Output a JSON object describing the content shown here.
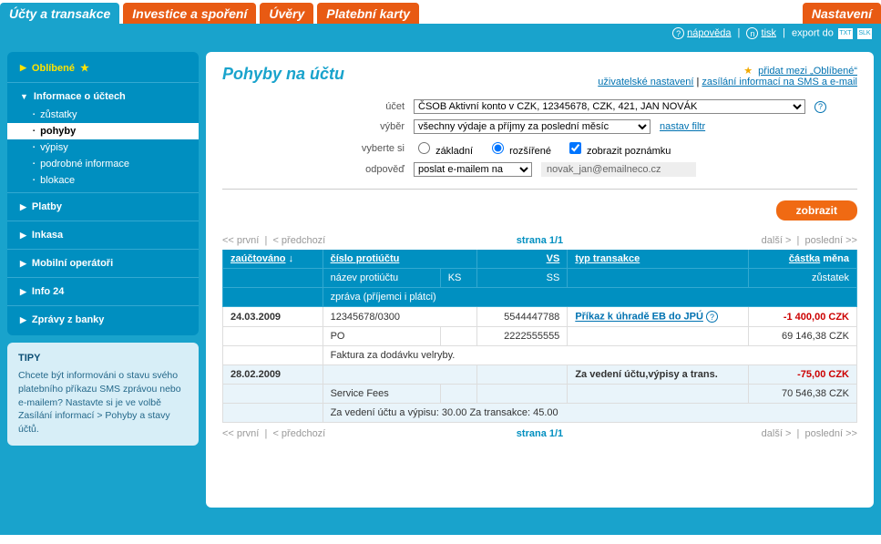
{
  "tabs": {
    "accounts": "Účty a transakce",
    "investments": "Investice a spoření",
    "loans": "Úvěry",
    "cards": "Platební karty",
    "settings": "Nastavení"
  },
  "header": {
    "help": "nápověda",
    "print": "tisk",
    "export": "export do",
    "fmt1": "TXT",
    "fmt2": "SLK"
  },
  "sidebar": {
    "favorites": "Oblíbené",
    "section_accounts": "Informace o účtech",
    "items": {
      "balances": "zůstatky",
      "movements": "pohyby",
      "statements": "výpisy",
      "details": "podrobné informace",
      "block": "blokace"
    },
    "payments": "Platby",
    "collections": "Inkasa",
    "mobile": "Mobilní operátoři",
    "info24": "Info 24",
    "messages": "Zprávy z banky"
  },
  "tips": {
    "title": "TIPY",
    "body": "Chcete být informováni o stavu svého platebního příkazu SMS zprávou nebo e-mailem? Nastavte si je ve volbě Zasílání informací > Pohyby a stavy účtů."
  },
  "page": {
    "title": "Pohyby na účtu",
    "add_fav": "přidat mezi „Oblíbené“",
    "user_settings": "uživatelské nastavení",
    "send_info": "zasílání informací na SMS a e-mail"
  },
  "filter": {
    "account_label": "účet",
    "account_value": "ČSOB Aktivní konto v CZK, 12345678, CZK, 421, JAN NOVÁK",
    "selection_label": "výběr",
    "selection_value": "všechny výdaje a příjmy za poslední měsíc",
    "set_filter": "nastav filtr",
    "choose_label": "vyberte si",
    "basic": "základní",
    "extended": "rozšířené",
    "show_note": "zobrazit poznámku",
    "response_label": "odpověď",
    "response_value": "poslat e-mailem na",
    "email_value": "novak_jan@emailneco.cz",
    "submit": "zobrazit"
  },
  "pager": {
    "first": "<< první",
    "prev": "< předchozí",
    "page": "strana 1/1",
    "next": "další >",
    "last": "poslední >>"
  },
  "table": {
    "headers": {
      "posted": "zaúčtováno",
      "counter": "číslo protiúčtu",
      "vs": "VS",
      "type": "typ transakce",
      "amount": "částka",
      "currency": "měna",
      "counter_name": "název protiúčtu",
      "ks": "KS",
      "ss": "SS",
      "balance": "zůstatek",
      "message": "zpráva (příjemci i plátci)"
    },
    "rows": [
      {
        "date": "24.03.2009",
        "counter_acct": "12345678/0300",
        "vs": "5544447788",
        "type": "Příkaz k úhradě EB do JPÚ",
        "amount": "-1 400,00 CZK",
        "counter_name": "PO",
        "ss": "2222555555",
        "balance": "69 146,38 CZK",
        "message": "Faktura za dodávku velryby."
      },
      {
        "date": "28.02.2009",
        "counter_acct": "",
        "vs": "",
        "type": "Za vedení účtu,výpisy a trans.",
        "amount": "-75,00 CZK",
        "counter_name": "Service Fees",
        "ss": "",
        "balance": "70 546,38 CZK",
        "message": "Za vedení účtu a výpisu: 30.00 Za transakce: 45.00"
      }
    ]
  }
}
